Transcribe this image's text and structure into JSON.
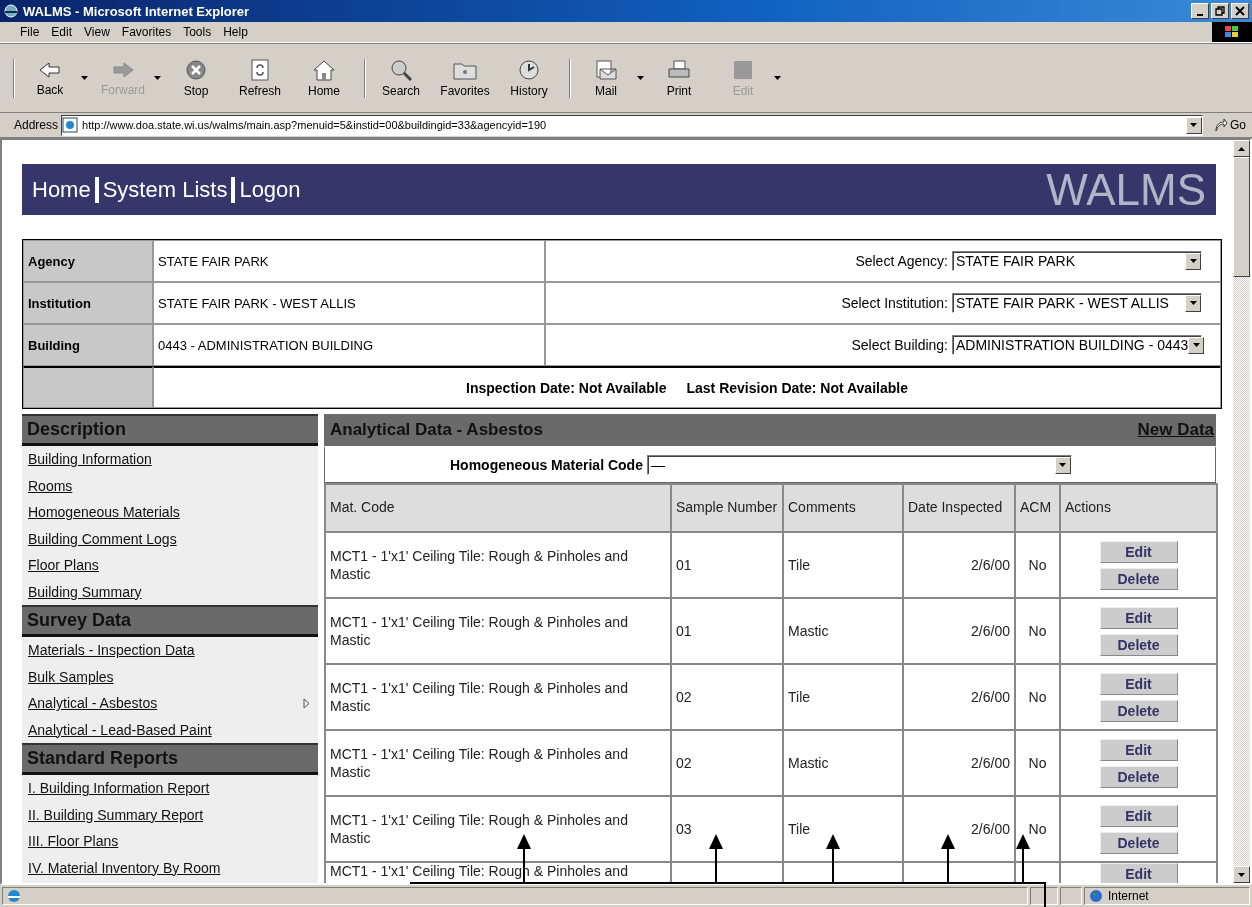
{
  "window": {
    "title": "WALMS - Microsoft Internet Explorer"
  },
  "menu": [
    "File",
    "Edit",
    "View",
    "Favorites",
    "Tools",
    "Help"
  ],
  "toolbar_groups": [
    {
      "buttons": [
        {
          "label": "Back",
          "kind": "back",
          "dropdown": true,
          "disabled": false
        },
        {
          "label": "Forward",
          "kind": "forward",
          "dropdown": true,
          "disabled": true
        },
        {
          "label": "Stop",
          "kind": "stop",
          "dropdown": false,
          "disabled": false
        },
        {
          "label": "Refresh",
          "kind": "refresh",
          "dropdown": false,
          "disabled": false
        },
        {
          "label": "Home",
          "kind": "home",
          "dropdown": false,
          "disabled": false
        }
      ]
    },
    {
      "buttons": [
        {
          "label": "Search",
          "kind": "search",
          "dropdown": false,
          "disabled": false
        },
        {
          "label": "Favorites",
          "kind": "favorites",
          "dropdown": false,
          "disabled": false
        },
        {
          "label": "History",
          "kind": "history",
          "dropdown": false,
          "disabled": false
        }
      ]
    },
    {
      "buttons": [
        {
          "label": "Mail",
          "kind": "mail",
          "dropdown": true,
          "disabled": false
        },
        {
          "label": "Print",
          "kind": "print",
          "dropdown": false,
          "disabled": false
        },
        {
          "label": "Edit",
          "kind": "edit",
          "dropdown": true,
          "disabled": true
        }
      ]
    }
  ],
  "address": {
    "label": "Address",
    "url": "http://www.doa.state.wi.us/walms/main.asp?menuid=5&instid=00&buildingid=33&agencyid=190",
    "go": "Go"
  },
  "banner": {
    "links": [
      "Home",
      "System Lists",
      "Logon"
    ],
    "logo": "WALMS"
  },
  "info": {
    "rows": [
      {
        "label": "Agency",
        "value": "STATE FAIR PARK",
        "select_label": "Select Agency:",
        "select_value": "STATE FAIR PARK"
      },
      {
        "label": "Institution",
        "value": "STATE FAIR PARK - WEST ALLIS",
        "select_label": "Select Institution:",
        "select_value": "STATE FAIR PARK - WEST ALLIS"
      },
      {
        "label": "Building",
        "value": "0443 - ADMINISTRATION BUILDING",
        "select_label": "Select Building:",
        "select_value": "ADMINISTRATION BUILDING - 0443"
      }
    ],
    "dates": [
      "Inspection Date: Not Available",
      "Last Revision Date: Not Available"
    ]
  },
  "sidebar": [
    {
      "title": "Description",
      "items": [
        {
          "label": "Building Information",
          "selected": false
        },
        {
          "label": "Rooms",
          "selected": false
        },
        {
          "label": "Homogeneous Materials",
          "selected": false
        },
        {
          "label": "Building Comment Logs",
          "selected": false
        },
        {
          "label": "Floor Plans",
          "selected": false
        },
        {
          "label": "Building Summary",
          "selected": false
        }
      ]
    },
    {
      "title": "Survey Data",
      "items": [
        {
          "label": "Materials - Inspection Data",
          "selected": false
        },
        {
          "label": "Bulk Samples",
          "selected": false
        },
        {
          "label": "Analytical - Asbestos",
          "selected": true
        },
        {
          "label": "Analytical - Lead-Based Paint",
          "selected": false
        }
      ]
    },
    {
      "title": "Standard Reports",
      "items": [
        {
          "label": "I. Building Information Report",
          "selected": false
        },
        {
          "label": "II. Building Summary Report",
          "selected": false
        },
        {
          "label": "III. Floor Plans",
          "selected": false
        },
        {
          "label": "IV. Material Inventory By Room",
          "selected": false
        }
      ]
    }
  ],
  "panel": {
    "title": "Analytical Data - Asbestos",
    "new_link": "New Data",
    "filter_label": "Homogeneous Material Code",
    "filter_value": "—",
    "columns": [
      "Mat. Code",
      "Sample Number",
      "Comments",
      "Date Inspected",
      "ACM",
      "Actions"
    ],
    "rows": [
      {
        "mat_code": "MCT1 - 1'x1' Ceiling Tile: Rough & Pinholes and Mastic",
        "sample": "01",
        "comments": "Tile",
        "date": "2/6/00",
        "acm": "No",
        "actions": [
          "Edit",
          "Delete"
        ]
      },
      {
        "mat_code": "MCT1 - 1'x1' Ceiling Tile: Rough & Pinholes and Mastic",
        "sample": "01",
        "comments": "Mastic",
        "date": "2/6/00",
        "acm": "No",
        "actions": [
          "Edit",
          "Delete"
        ]
      },
      {
        "mat_code": "MCT1 - 1'x1' Ceiling Tile: Rough & Pinholes and Mastic",
        "sample": "02",
        "comments": "Tile",
        "date": "2/6/00",
        "acm": "No",
        "actions": [
          "Edit",
          "Delete"
        ]
      },
      {
        "mat_code": "MCT1 - 1'x1' Ceiling Tile: Rough & Pinholes and Mastic",
        "sample": "02",
        "comments": "Mastic",
        "date": "2/6/00",
        "acm": "No",
        "actions": [
          "Edit",
          "Delete"
        ]
      },
      {
        "mat_code": "MCT1 - 1'x1' Ceiling Tile: Rough & Pinholes and Mastic",
        "sample": "03",
        "comments": "Tile",
        "date": "2/6/00",
        "acm": "No",
        "actions": [
          "Edit",
          "Delete"
        ]
      },
      {
        "mat_code": "MCT1 - 1'x1' Ceiling Tile: Rough & Pinholes and",
        "actions": [
          "Edit"
        ]
      }
    ]
  },
  "status": {
    "zone": "Internet"
  }
}
